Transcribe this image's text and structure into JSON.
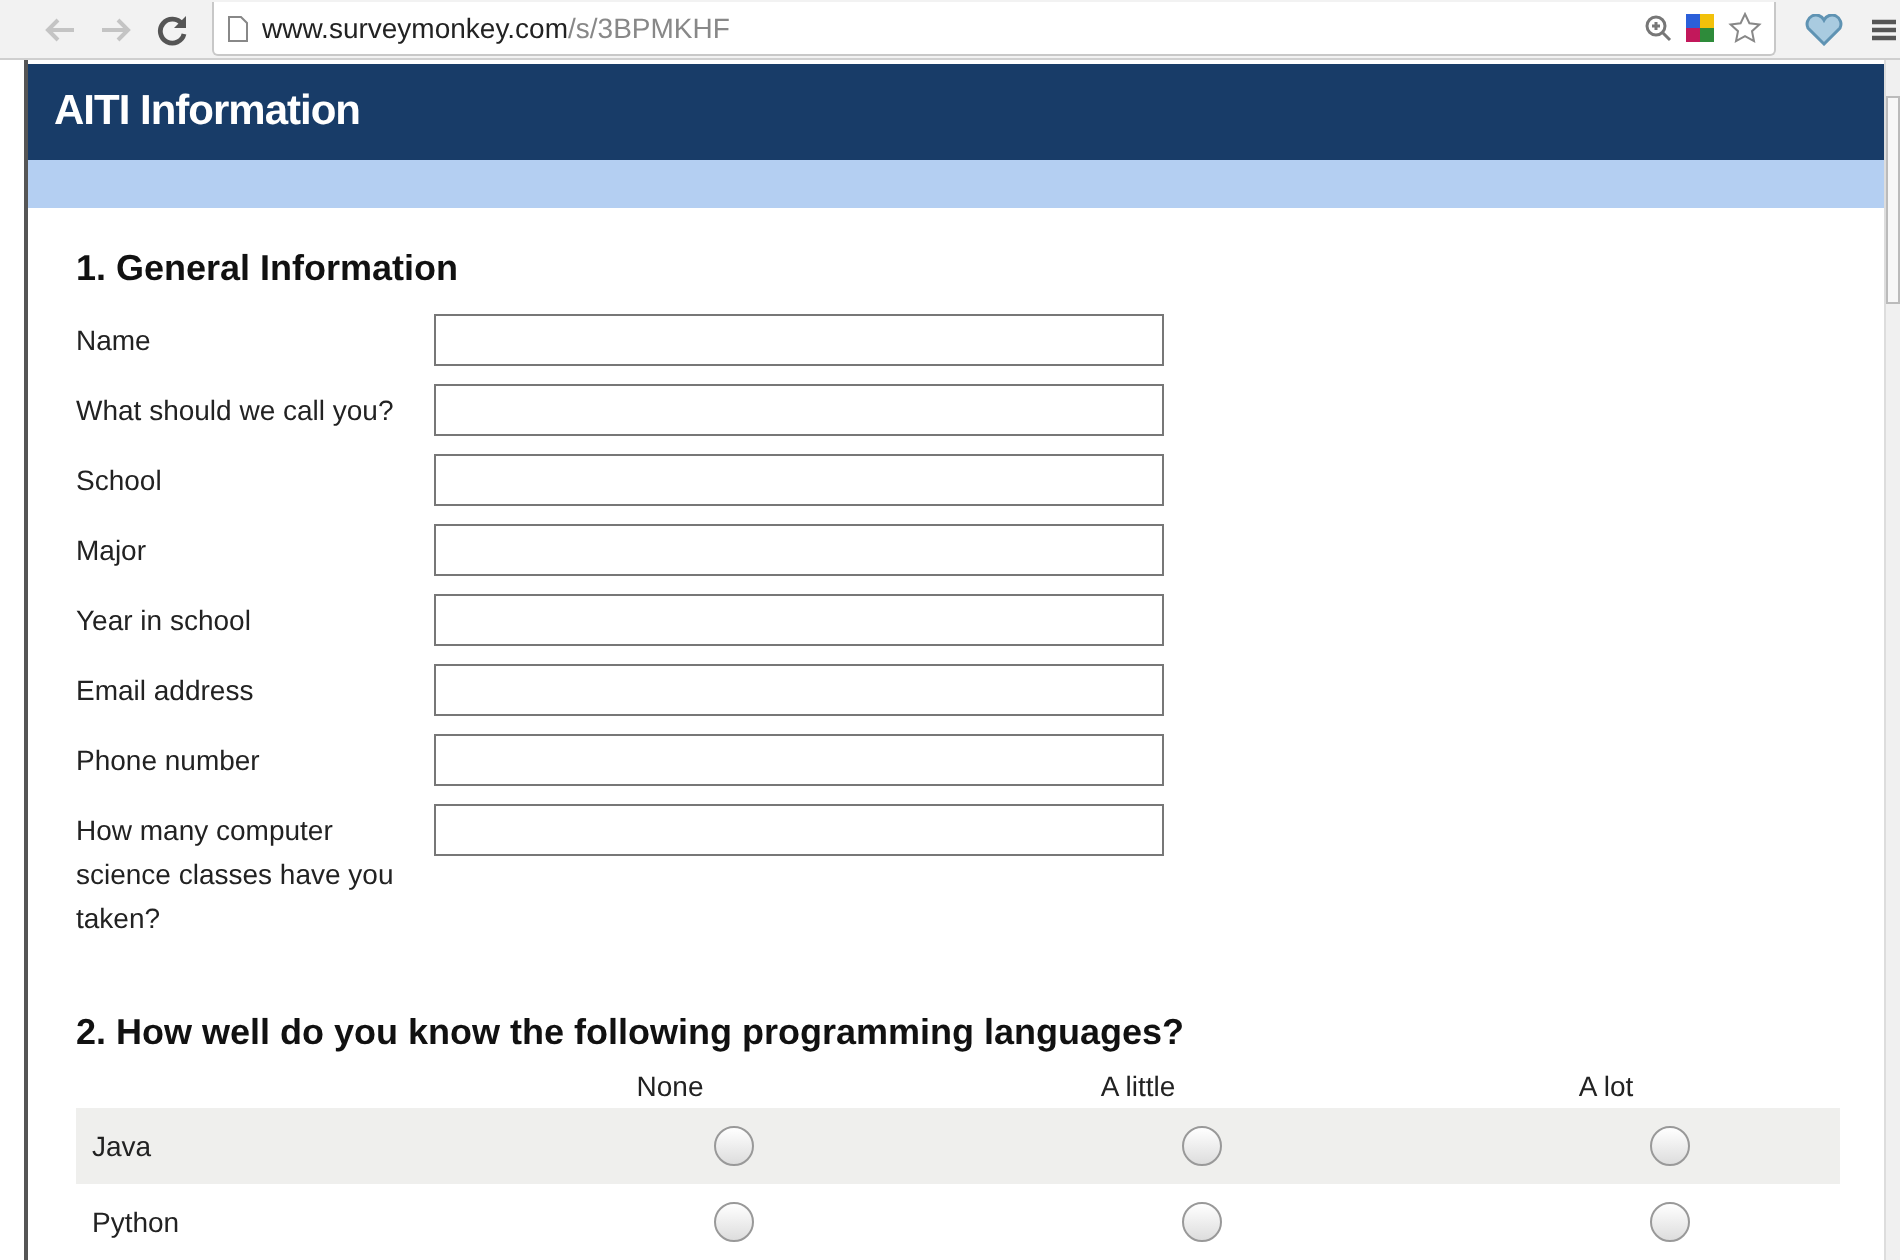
{
  "browser": {
    "address_host": "www.surveymonkey.com",
    "address_path": "/s/3BPMKHF"
  },
  "survey": {
    "title": "AITI Information"
  },
  "section_1": {
    "title": "1. General Information",
    "fields": [
      {
        "label": "Name"
      },
      {
        "label": "What should we call you?"
      },
      {
        "label": "School"
      },
      {
        "label": "Major"
      },
      {
        "label": "Year in school"
      },
      {
        "label": "Email address"
      },
      {
        "label": "Phone number"
      },
      {
        "label": "How many computer science classes have you taken?"
      }
    ]
  },
  "section_2": {
    "title": "2. How well do you know the following programming languages?",
    "columns": [
      "None",
      "A little",
      "A lot"
    ],
    "rows": [
      {
        "label": "Java",
        "options": [
          {
            "selected": false
          },
          {
            "selected": false
          },
          {
            "selected": false
          }
        ]
      },
      {
        "label": "Python",
        "options": [
          {
            "selected": false
          },
          {
            "selected": false
          },
          {
            "selected": false
          }
        ]
      }
    ]
  }
}
